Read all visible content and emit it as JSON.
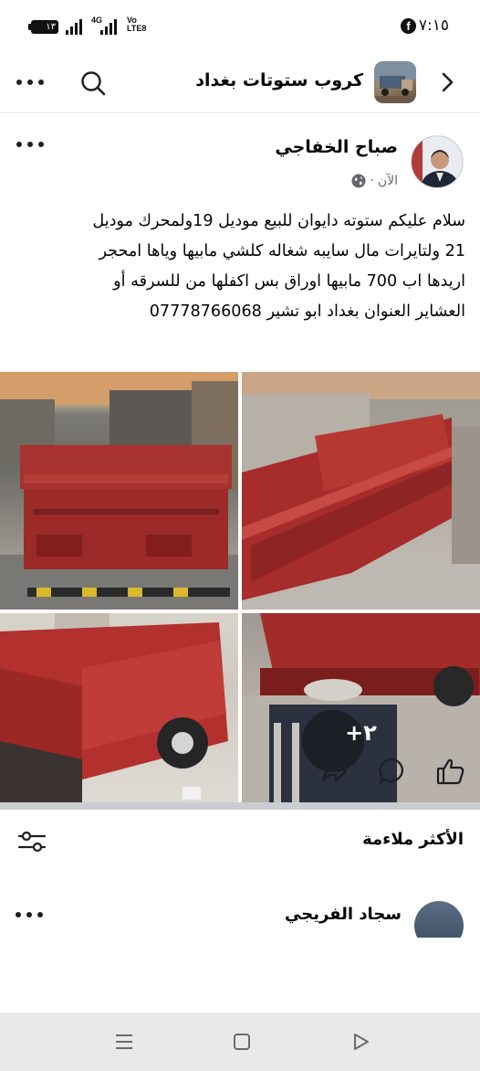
{
  "status_bar": {
    "time": "٧:١٥",
    "battery": "١٣",
    "network_1": "4G",
    "network_2_line1": "Vo",
    "network_2_line2": "LTE",
    "network_2_badge": "8",
    "app_badge": "f"
  },
  "group_header": {
    "group_name": "كروب ستوتات بغداد",
    "back_icon": "chevron-right-icon",
    "search_icon": "search-icon",
    "more_icon": "more-horizontal-icon"
  },
  "post": {
    "author": "صباح الخفاجي",
    "time": "الآن",
    "separator": "·",
    "audience_icon": "globe-icon",
    "text_lines": [
      "سلام عليكم ستوته دايوان للبيع موديل 19ولمحرك موديل",
      "21 ولتايرات مال سايبه شغاله كلشي مابيها وياها امحجر",
      "اريدها اب 700 مابيها اوراق بس اكفلها من للسرقه أو",
      "العشاير العنوان بغداد ابو تشير 07778766068"
    ],
    "photos_more_label": "+٢",
    "photo_count": 4
  },
  "actions": {
    "like_icon": "like-icon",
    "comment_icon": "comment-icon",
    "share_icon": "share-icon"
  },
  "comments": {
    "sort_label": "الأكثر ملاءمة",
    "filter_icon": "sliders-icon",
    "first_commenter": "سجاد الفريجي"
  },
  "colors": {
    "text_primary": "#050505",
    "text_secondary": "#65676b",
    "divider": "#c9ccd1",
    "nav_bar": "#e9e9ea"
  }
}
